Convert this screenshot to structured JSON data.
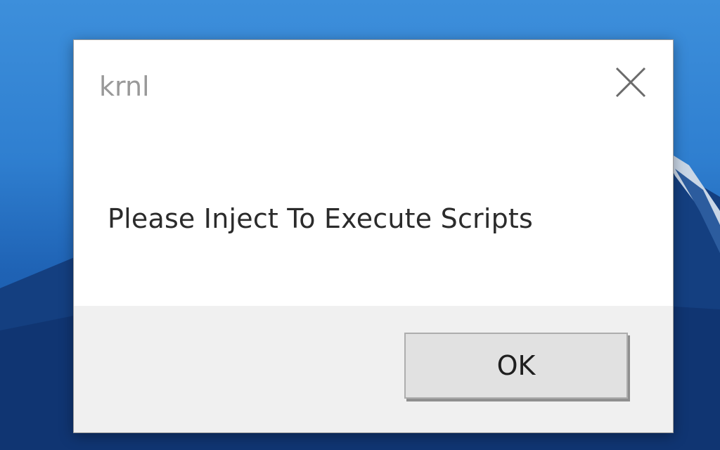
{
  "dialog": {
    "title": "krnl",
    "close_icon": "close-icon",
    "message": "Please Inject To Execute Scripts",
    "ok_label": "OK"
  },
  "colors": {
    "desktop_blue": "#2f7fd0",
    "footer_gray": "#f0f0f0",
    "title_gray": "#999999"
  }
}
